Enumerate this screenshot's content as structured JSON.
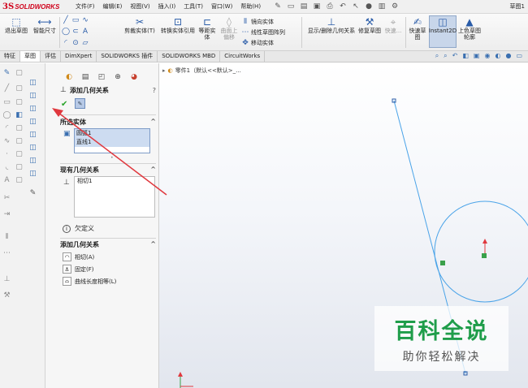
{
  "app": {
    "logo_ds": "3S",
    "logo_text": "SOLIDWORKS",
    "doc_title": "草图1"
  },
  "menu": [
    "文件(F)",
    "编辑(E)",
    "视图(V)",
    "插入(I)",
    "工具(T)",
    "窗口(W)",
    "帮助(H)"
  ],
  "ribbon": {
    "exit_sketch": "退出草图",
    "smart_dim": "智能尺寸",
    "trim": "剪裁实体(T)",
    "convert": "转换实体引用",
    "offset": "等距实体",
    "surface_offset": "曲面上偏移",
    "mirror": "镜向实体",
    "linear_pattern": "线性草图阵列",
    "move": "移动实体",
    "display_relations": "显示/删除几何关系",
    "repair": "修复草图",
    "quick_snap": "快速...",
    "rapid_sketch": "快速草图",
    "instant2d": "Instant2D",
    "shaded_contours": "上色草图轮廓"
  },
  "tabs": [
    "特征",
    "草图",
    "评估",
    "DimXpert",
    "SOLIDWORKS 插件",
    "SOLIDWORKS MBD",
    "CircuitWorks"
  ],
  "active_tab": "草图",
  "tree": {
    "label": "零件1（默认<<默认>_..."
  },
  "property_manager": {
    "title": "添加几何关系",
    "selected_group": "所选实体",
    "selected_items": [
      "圆弧1",
      "直线1"
    ],
    "existing_group": "现有几何关系",
    "existing_items": [
      "相切1"
    ],
    "status": "欠定义",
    "add_group": "添加几何关系",
    "add_items": [
      "相切(A)",
      "固定(F)",
      "曲线长度相等(L)"
    ]
  },
  "watermark": {
    "title": "百科全说",
    "subtitle": "助你轻松解决"
  },
  "colors": {
    "accent": "#2a5ca8",
    "arrow": "#e0383e",
    "circle": "#4aa3e8",
    "ok": "#29a329",
    "watermark": "#1f9d4a"
  }
}
